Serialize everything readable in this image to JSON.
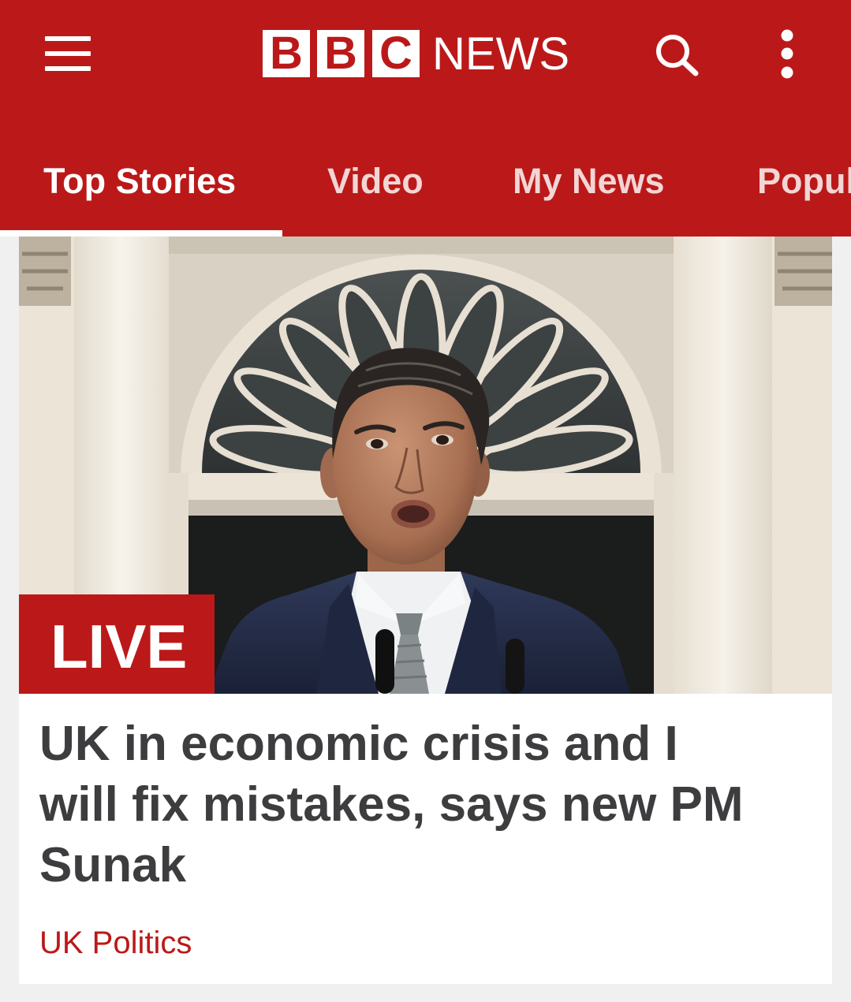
{
  "header": {
    "brand": {
      "letters": [
        "B",
        "B",
        "C"
      ],
      "word": "NEWS"
    },
    "icons": {
      "menu": "hamburger-menu-icon",
      "search": "search-icon",
      "more": "more-vertical-icon"
    }
  },
  "tabs": [
    {
      "label": "Top Stories"
    },
    {
      "label": "Video"
    },
    {
      "label": "My News"
    },
    {
      "label": "Popul"
    }
  ],
  "active_tab_index": 0,
  "story": {
    "badge": "LIVE",
    "headline": "UK in economic crisis and I will fix mistakes, says new PM Sunak",
    "category": "UK Politics"
  },
  "colors": {
    "brand_red": "#bb1919",
    "headline_text": "#3d3d3f",
    "page_background": "#f0f0f0",
    "card_background": "#ffffff"
  }
}
